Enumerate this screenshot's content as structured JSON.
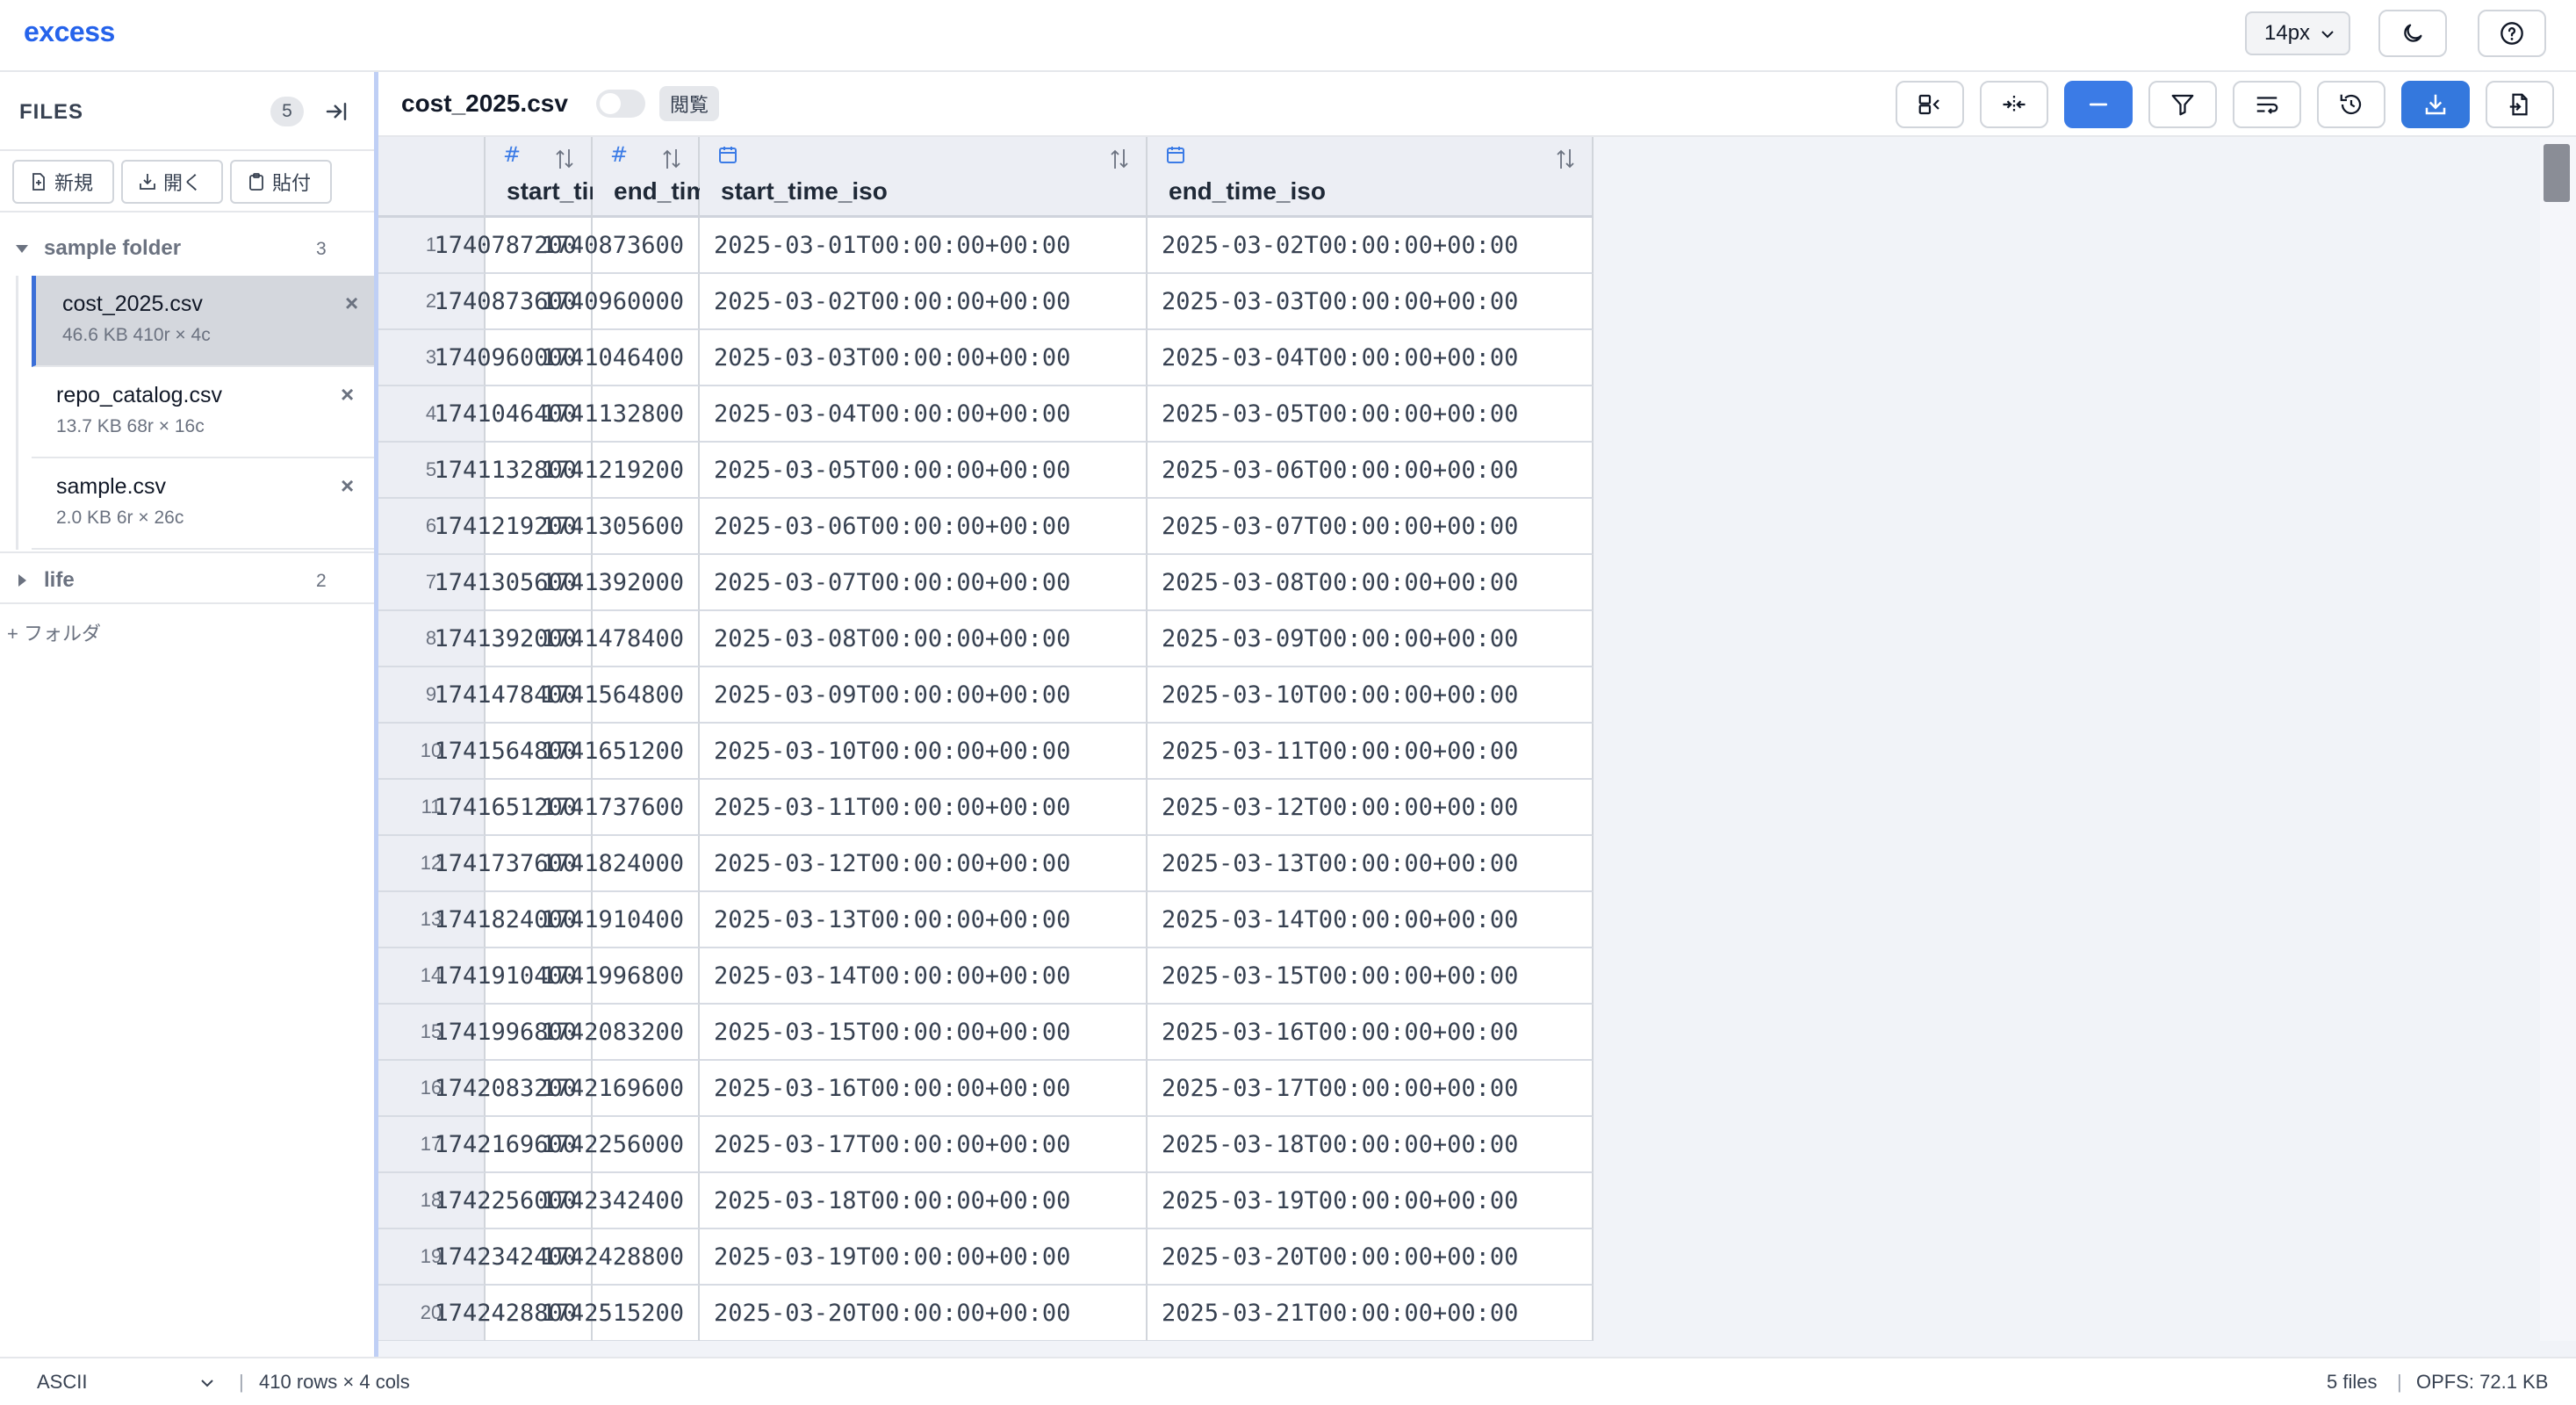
{
  "app": {
    "logo": "excess"
  },
  "topbar": {
    "font_size": "14px"
  },
  "sidebar": {
    "title": "FILES",
    "count": "5",
    "actions": {
      "new": "新規",
      "open": "開く",
      "paste": "貼付"
    },
    "folders": [
      {
        "name": "sample folder",
        "count": "3",
        "expanded": true
      },
      {
        "name": "life",
        "count": "2",
        "expanded": false
      }
    ],
    "files": [
      {
        "name": "cost_2025.csv",
        "meta": "46.6 KB   410r × 4c",
        "close": "×"
      },
      {
        "name": "repo_catalog.csv",
        "meta": "13.7 KB   68r × 16c",
        "close": "×"
      },
      {
        "name": "sample.csv",
        "meta": "2.0 KB   6r × 26c",
        "close": "×"
      }
    ],
    "add_folder": "+ フォルダ"
  },
  "main": {
    "file_name": "cost_2025.csv",
    "view_mode": "閲覧",
    "columns": [
      {
        "name": "start_time",
        "type_icon": "#"
      },
      {
        "name": "end_time",
        "type_icon": "#"
      },
      {
        "name": "start_time_iso",
        "type_icon": "calendar-icon"
      },
      {
        "name": "end_time_iso",
        "type_icon": "calendar-icon"
      }
    ],
    "rows": [
      [
        "1",
        "1740787200",
        "1740873600",
        "2025-03-01T00:00:00+00:00",
        "2025-03-02T00:00:00+00:00"
      ],
      [
        "2",
        "1740873600",
        "1740960000",
        "2025-03-02T00:00:00+00:00",
        "2025-03-03T00:00:00+00:00"
      ],
      [
        "3",
        "1740960000",
        "1741046400",
        "2025-03-03T00:00:00+00:00",
        "2025-03-04T00:00:00+00:00"
      ],
      [
        "4",
        "1741046400",
        "1741132800",
        "2025-03-04T00:00:00+00:00",
        "2025-03-05T00:00:00+00:00"
      ],
      [
        "5",
        "1741132800",
        "1741219200",
        "2025-03-05T00:00:00+00:00",
        "2025-03-06T00:00:00+00:00"
      ],
      [
        "6",
        "1741219200",
        "1741305600",
        "2025-03-06T00:00:00+00:00",
        "2025-03-07T00:00:00+00:00"
      ],
      [
        "7",
        "1741305600",
        "1741392000",
        "2025-03-07T00:00:00+00:00",
        "2025-03-08T00:00:00+00:00"
      ],
      [
        "8",
        "1741392000",
        "1741478400",
        "2025-03-08T00:00:00+00:00",
        "2025-03-09T00:00:00+00:00"
      ],
      [
        "9",
        "1741478400",
        "1741564800",
        "2025-03-09T00:00:00+00:00",
        "2025-03-10T00:00:00+00:00"
      ],
      [
        "10",
        "1741564800",
        "1741651200",
        "2025-03-10T00:00:00+00:00",
        "2025-03-11T00:00:00+00:00"
      ],
      [
        "11",
        "1741651200",
        "1741737600",
        "2025-03-11T00:00:00+00:00",
        "2025-03-12T00:00:00+00:00"
      ],
      [
        "12",
        "1741737600",
        "1741824000",
        "2025-03-12T00:00:00+00:00",
        "2025-03-13T00:00:00+00:00"
      ],
      [
        "13",
        "1741824000",
        "1741910400",
        "2025-03-13T00:00:00+00:00",
        "2025-03-14T00:00:00+00:00"
      ],
      [
        "14",
        "1741910400",
        "1741996800",
        "2025-03-14T00:00:00+00:00",
        "2025-03-15T00:00:00+00:00"
      ],
      [
        "15",
        "1741996800",
        "1742083200",
        "2025-03-15T00:00:00+00:00",
        "2025-03-16T00:00:00+00:00"
      ],
      [
        "16",
        "1742083200",
        "1742169600",
        "2025-03-16T00:00:00+00:00",
        "2025-03-17T00:00:00+00:00"
      ],
      [
        "17",
        "1742169600",
        "1742256000",
        "2025-03-17T00:00:00+00:00",
        "2025-03-18T00:00:00+00:00"
      ],
      [
        "18",
        "1742256000",
        "1742342400",
        "2025-03-18T00:00:00+00:00",
        "2025-03-19T00:00:00+00:00"
      ],
      [
        "19",
        "1742342400",
        "1742428800",
        "2025-03-19T00:00:00+00:00",
        "2025-03-20T00:00:00+00:00"
      ],
      [
        "20",
        "1742428800",
        "1742515200",
        "2025-03-20T00:00:00+00:00",
        "2025-03-21T00:00:00+00:00"
      ]
    ]
  },
  "statusbar": {
    "encoding": "ASCII",
    "separator": "|",
    "rows_cols": "410 rows × 4 cols",
    "files": "5 files",
    "opfs": "OPFS: 72.1 KB"
  },
  "colors": {
    "accent": "#3b7be6",
    "logo": "#2563eb",
    "active_file_bg": "#d4d7dd"
  }
}
